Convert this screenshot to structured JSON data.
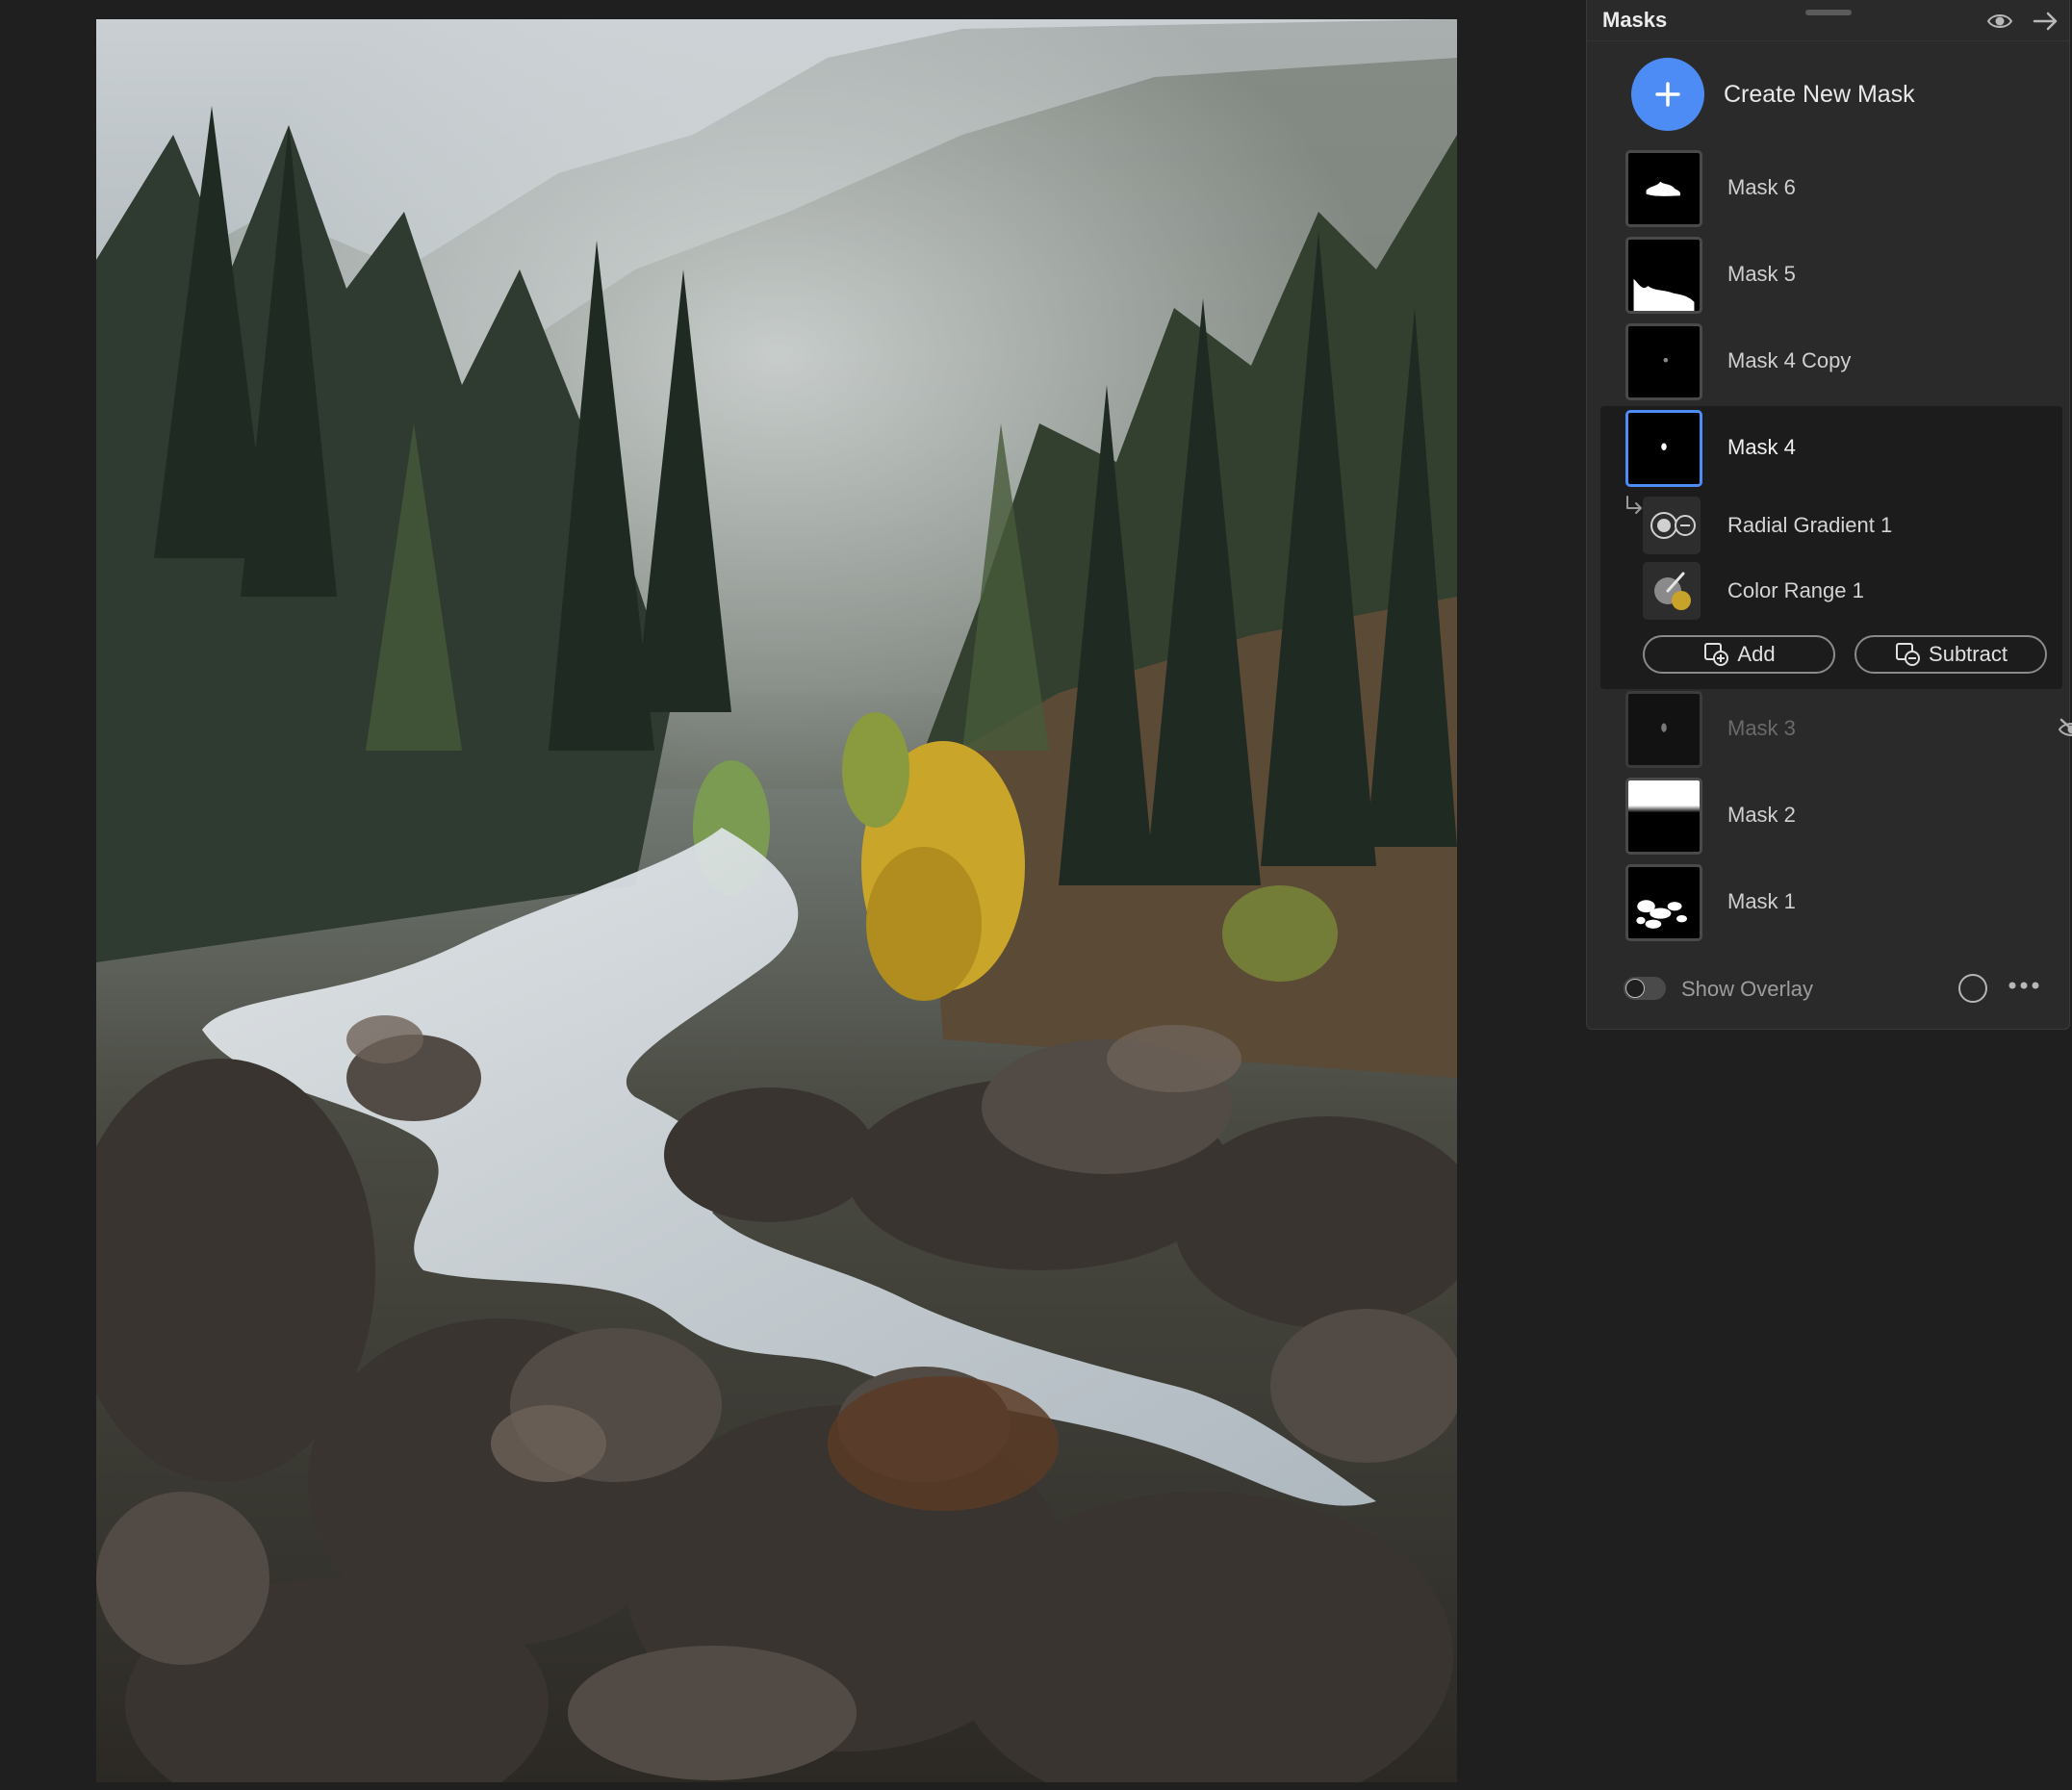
{
  "panel": {
    "title": "Masks",
    "create_label": "Create New Mask",
    "masks": [
      {
        "label": "Mask 6"
      },
      {
        "label": "Mask 5"
      },
      {
        "label": "Mask 4 Copy"
      },
      {
        "label": "Mask 4",
        "selected": true,
        "components": [
          {
            "label": "Radial Gradient 1",
            "icon": "radial-gradient-icon"
          },
          {
            "label": "Color Range 1",
            "icon": "color-range-icon"
          }
        ]
      },
      {
        "label": "Mask 3",
        "hidden": true
      },
      {
        "label": "Mask 2"
      },
      {
        "label": "Mask 1"
      }
    ],
    "add_label": "Add",
    "subtract_label": "Subtract",
    "overlay_label": "Show Overlay",
    "overlay_on": false
  },
  "colors": {
    "accent": "#4e8cf5",
    "panel_bg": "#2a2a2a",
    "selected_bg": "#1c1c1c",
    "app_bg": "#1f1f1f"
  }
}
